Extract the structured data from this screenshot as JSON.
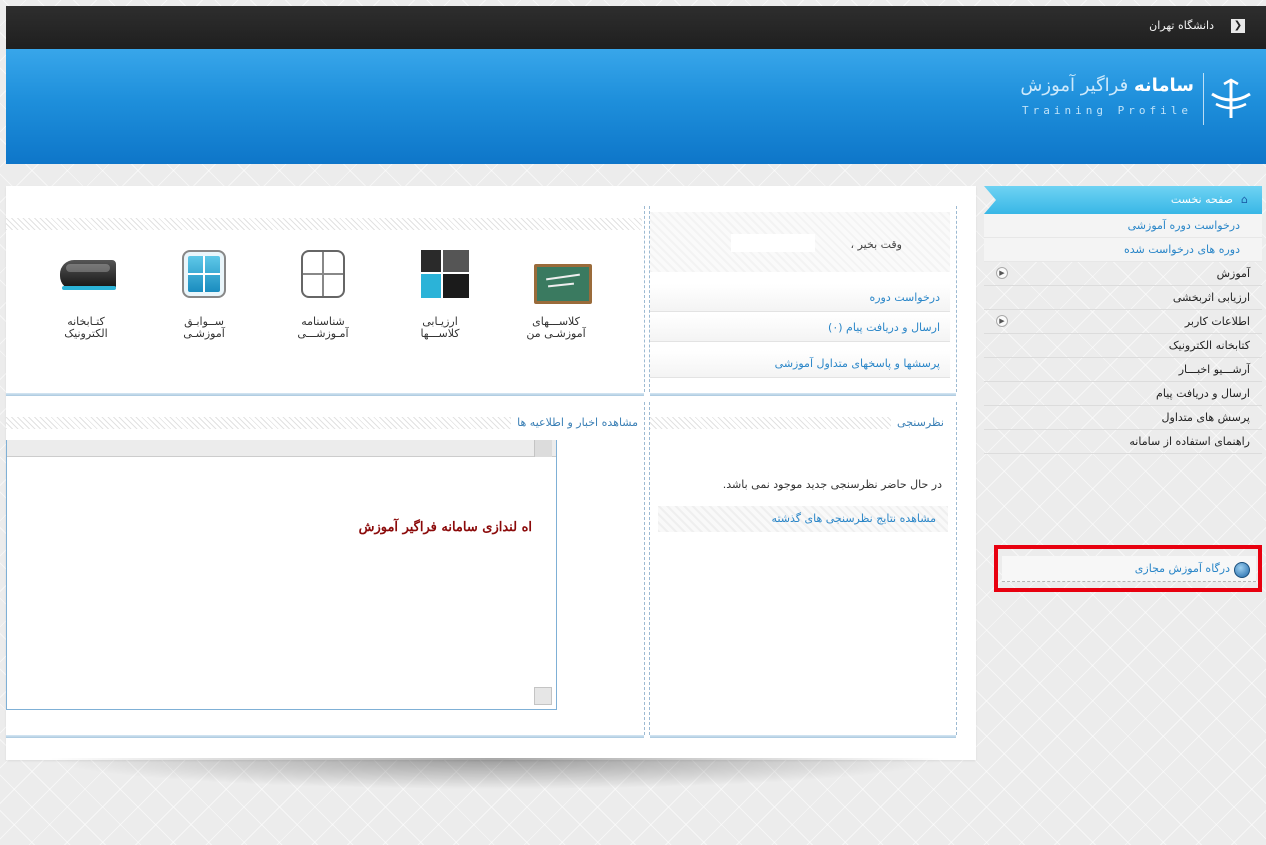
{
  "topbar": {
    "university": "دانشگاه تهران",
    "toggle_icon": "chevron-right-icon"
  },
  "banner": {
    "title_bold": "سامانه",
    "title_rest": "فراگیر آموزش",
    "subtitle": "Training Profile"
  },
  "sidebar": {
    "home": "صفحه نخست",
    "sub_items": [
      "درخواست دوره آموزشی",
      "دوره های درخواست شده"
    ],
    "items": [
      {
        "label": "آموزش",
        "expandable": true
      },
      {
        "label": "ارزیابی اثربخشی",
        "expandable": false
      },
      {
        "label": "اطلاعات کاربر",
        "expandable": true
      },
      {
        "label": "کتابخانه الکترونیک",
        "expandable": false
      },
      {
        "label": "آرشـــیو اخبـــار",
        "expandable": false
      },
      {
        "label": "ارسال و دریافت پیام",
        "expandable": false
      },
      {
        "label": "پرسش های متداول",
        "expandable": false
      },
      {
        "label": "راهنمای استفاده از سامانه",
        "expandable": false
      }
    ],
    "portal": "درگاه آموزش مجازی"
  },
  "greeting": {
    "welcome": "وقت بخیر ،"
  },
  "quick_links": [
    "درخواست دوره",
    "ارسال و دریافت پیام (۰)",
    "پرسشها و پاسخهای متداول آموزشی"
  ],
  "apps": [
    {
      "line1": "کلاســـهای",
      "line2": "آموزشـی من",
      "icon": "chalkboard-icon"
    },
    {
      "line1": "ارزیـابی",
      "line2": "کلاســـها",
      "icon": "evaluation-icon"
    },
    {
      "line1": "شناسنامه",
      "line2": "آمـوزشـــی",
      "icon": "profile-card-icon"
    },
    {
      "line1": "ســوابـق",
      "line2": "آموزشـی",
      "icon": "records-icon"
    },
    {
      "line1": "کتـابخانه",
      "line2": "الکترونیک",
      "icon": "library-icon"
    }
  ],
  "survey": {
    "title": "نظرسنجی",
    "message": "در حال حاضر نظرسنجی جدید موجود نمی باشد.",
    "link": "مشاهده نتایج نظرسنجی های گذشته"
  },
  "news": {
    "title": "مشاهده اخبار و اطلاعیه ها",
    "content": "اه لندازی سامانه فراگیر آموزش"
  },
  "colors": {
    "banner": "#1e8fdb",
    "home_tab": "#38b7e6",
    "link": "#2a86c8",
    "highlight_box": "#e8000f",
    "news_text": "#8b0a0a"
  }
}
